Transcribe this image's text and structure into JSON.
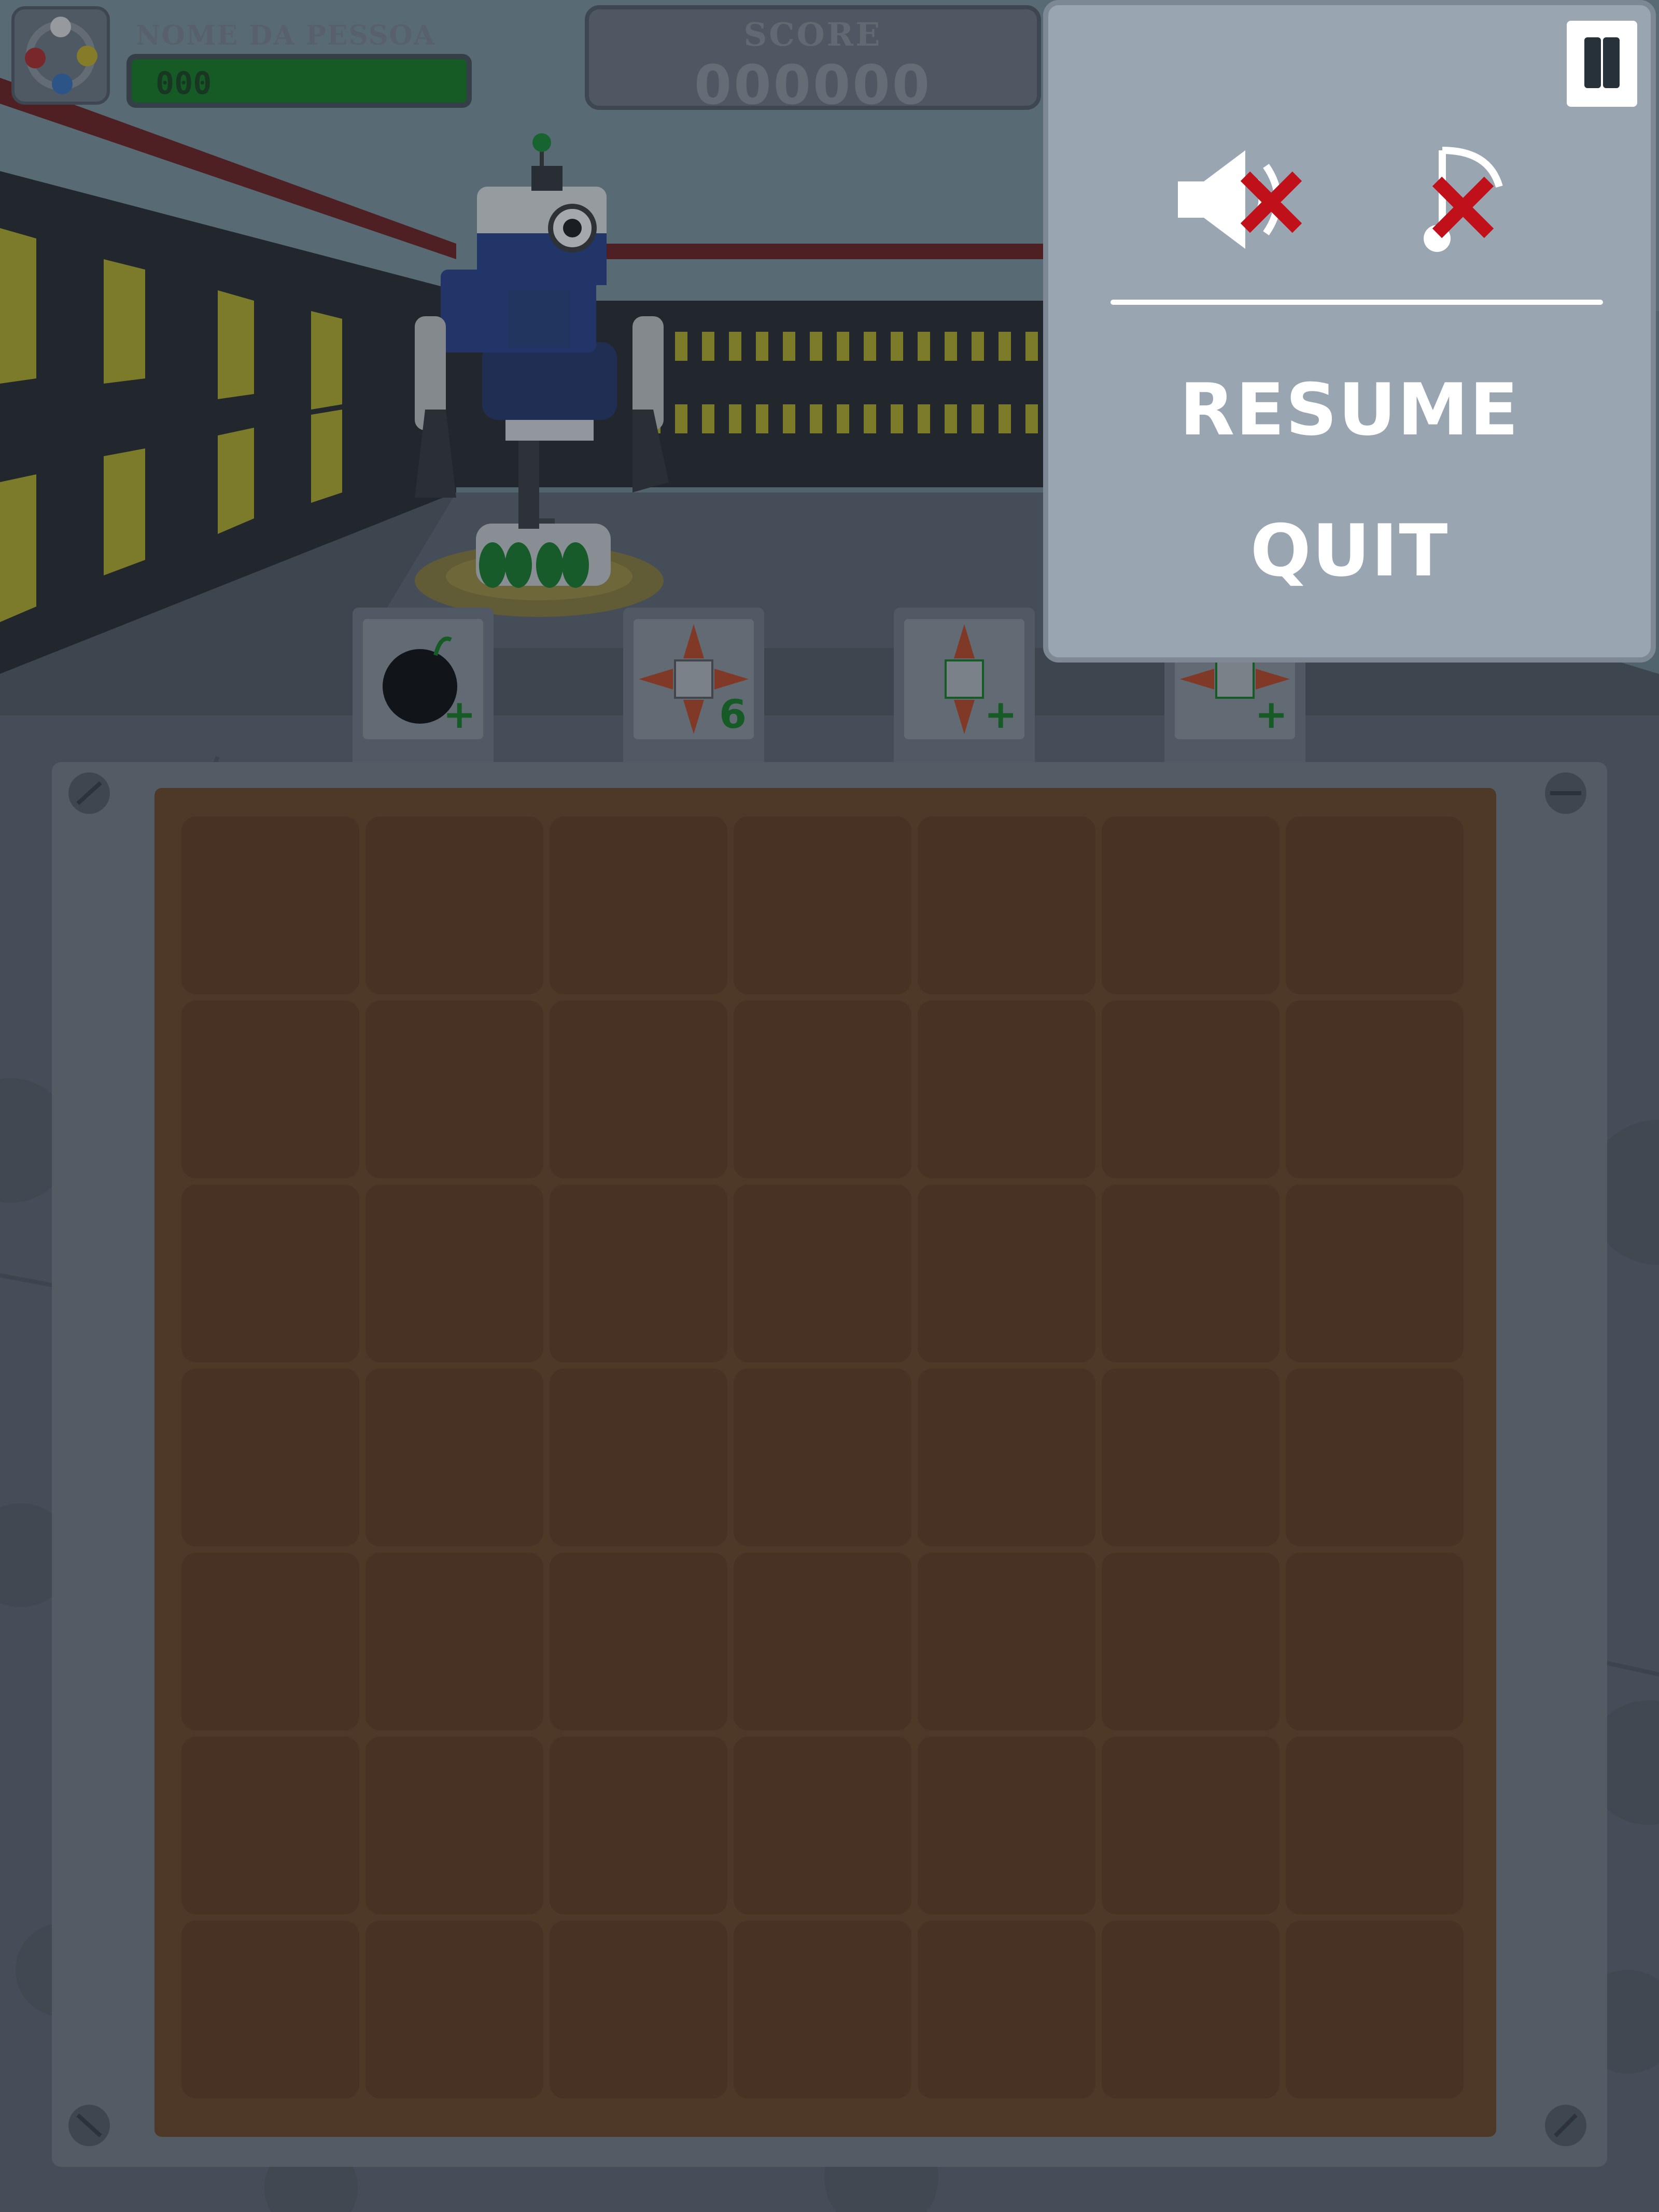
{
  "hud": {
    "player_name": "NOME DA PESSOA",
    "player_hp": "000",
    "score_label": "SCORE",
    "score_value": "000000"
  },
  "powerups": [
    {
      "name": "bomb",
      "badge": "+"
    },
    {
      "name": "cross-rocket",
      "badge": "6"
    },
    {
      "name": "vertical-rocket",
      "badge": "+"
    },
    {
      "name": "horizontal-rocket",
      "badge": "+"
    }
  ],
  "pause_menu": {
    "sound_icon": "speaker-muted-icon",
    "music_icon": "music-note-muted-icon",
    "resume_label": "RESUME",
    "quit_label": "QUIT"
  },
  "board": {
    "rows": 7,
    "cols": 7
  },
  "colors": {
    "hp_green": "#0a7a18",
    "mute_red": "#c0111a",
    "board_brown": "#6a3e1a",
    "panel_gray": "#9aa5b2"
  }
}
